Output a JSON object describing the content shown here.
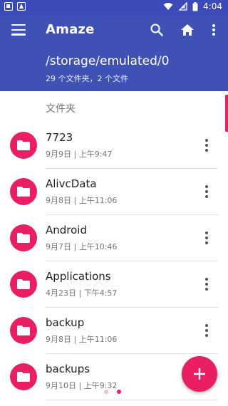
{
  "status_bar": {
    "time": "4:04"
  },
  "app_bar": {
    "title": "Amaze",
    "current_path": "/storage/emulated/0",
    "summary": "29 个文件夹，2 个文件"
  },
  "section": {
    "header": "文件夹"
  },
  "items": [
    {
      "name": "7723",
      "meta": "9月9日 | 上午9:47"
    },
    {
      "name": "AlivcData",
      "meta": "9月8日 | 上午11:06"
    },
    {
      "name": "Android",
      "meta": "9月7日 | 上午10:46"
    },
    {
      "name": "Applications",
      "meta": "4月23日 | 下午4:57"
    },
    {
      "name": "backup",
      "meta": "9月8日 | 上午11:06"
    },
    {
      "name": "backups",
      "meta": "9月10日 | 上午9:32"
    }
  ],
  "colors": {
    "primary": "#3f51b5",
    "accent": "#e91e63"
  },
  "icons": {
    "menu": "menu-icon",
    "search": "search-icon",
    "home": "home-icon",
    "overflow": "more-vert-icon",
    "folder": "folder-icon",
    "fab": "plus-icon"
  }
}
